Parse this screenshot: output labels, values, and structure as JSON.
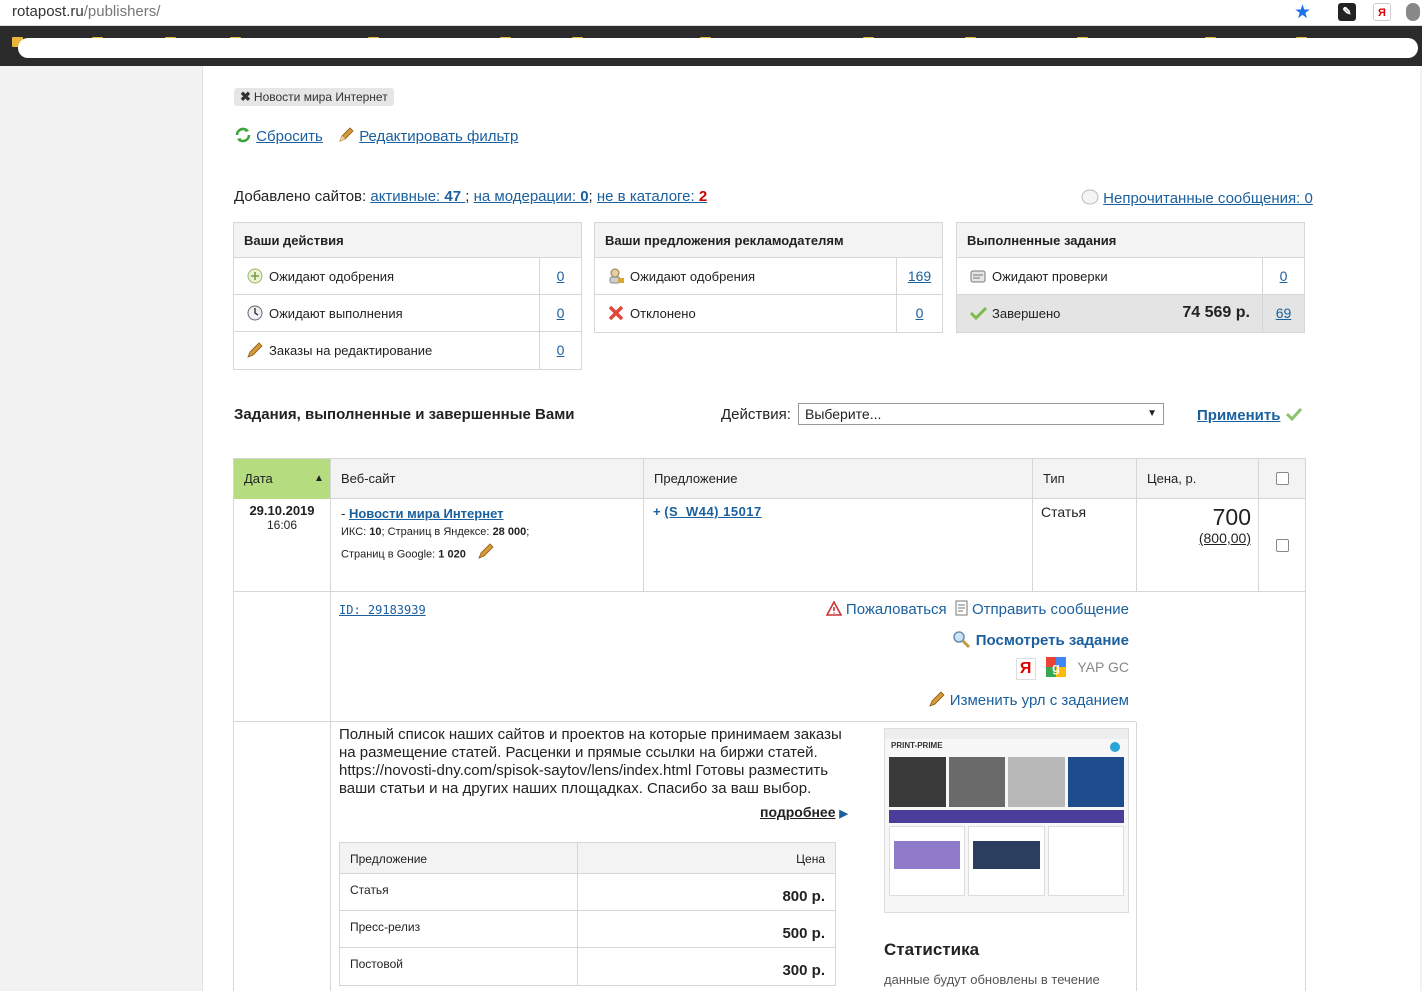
{
  "browser": {
    "url_host": "rotapost.ru",
    "url_path": "/publishers/"
  },
  "filter": {
    "tag_label": "Новости мира Интернет",
    "reset_label": "Сбросить",
    "edit_label": "Редактировать фильтр"
  },
  "summary": {
    "added_label": "Добавлено сайтов:",
    "active_label": "активные:",
    "active_count": "47",
    "moderation_label": "на модерации:",
    "moderation_count": "0",
    "not_in_catalog_label": "не в каталоге:",
    "not_in_catalog_count": "2",
    "unread_label": "Непрочитанные сообщения: 0"
  },
  "panels": {
    "actions": {
      "title": "Ваши действия",
      "rows": [
        {
          "label": "Ожидают одобрения",
          "count": "0"
        },
        {
          "label": "Ожидают выполнения",
          "count": "0"
        },
        {
          "label": "Заказы на редактирование",
          "count": "0"
        }
      ]
    },
    "offers": {
      "title": "Ваши предложения рекламодателям",
      "rows": [
        {
          "label": "Ожидают одобрения",
          "count": "169"
        },
        {
          "label": "Отклонено",
          "count": "0"
        }
      ]
    },
    "completed": {
      "title": "Выполненные задания",
      "rows": [
        {
          "label": "Ожидают проверки",
          "count": "0"
        },
        {
          "label": "Завершено",
          "amount": "74 569 р.",
          "count": "69"
        }
      ]
    }
  },
  "tasks": {
    "heading": "Задания, выполненные и завершенные Вами",
    "actions_label": "Действия:",
    "select_value": "Выберите...",
    "apply_label": "Применить",
    "columns": [
      "Дата",
      "Веб-сайт",
      "Предложение",
      "Тип",
      "Цена, р."
    ],
    "row": {
      "date": "29.10.2019",
      "time": "16:06",
      "site_prefix": "-",
      "site_name": "Новости мира Интернет",
      "iks_label": "ИКС:",
      "iks_value": "10",
      "yandex_label": "; Страниц в Яндексе:",
      "yandex_value": "28 000",
      "google_label": "Страниц в Google:",
      "google_value": "1 020",
      "offer_prefix": "+",
      "offer_link": "(S_W44) 15017",
      "type": "Статья",
      "price": "700",
      "price_orig": "(800,00)",
      "id_link": "ID: 29183939",
      "complain": "Пожаловаться",
      "send_message": "Отправить сообщение",
      "view_task": "Посмотреть задание",
      "yap_gc": "YAP GC",
      "change_url": "Изменить урл с заданием"
    }
  },
  "site_info": {
    "description": "Полный список наших сайтов и проектов на которые принимаем заказы на размещение статей. Расценки и прямые ссылки на биржи статей. https://novosti-dny.com/spisok-saytov/lens/index.html Готовы разместить ваши статьи и на других наших площадках. Спасибо за ваш выбор.",
    "more_label": "подробнее",
    "price_table": {
      "col_offer": "Предложение",
      "col_price": "Цена",
      "rows": [
        {
          "name": "Статья",
          "price": "800 р."
        },
        {
          "name": "Пресс-релиз",
          "price": "500 р."
        },
        {
          "name": "Постовой",
          "price": "300 р."
        }
      ]
    },
    "stats_title": "Статистика",
    "stats_note": "данные будут обновлены в течение",
    "thumb_logo": "PRINT-PRIME"
  },
  "colors": {
    "link": "#1a5f9e",
    "date_header_bg": "#b5dc7f",
    "red_count": "#cc0000"
  }
}
